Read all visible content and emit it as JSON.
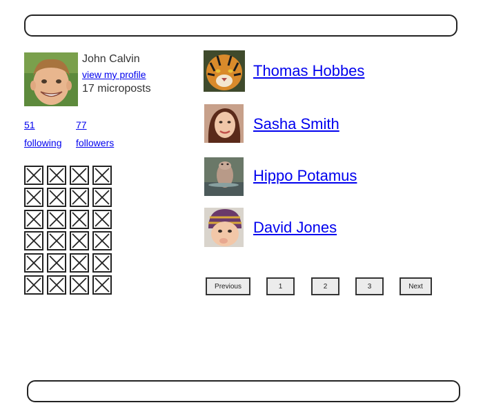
{
  "header": {},
  "profile": {
    "name": "John Calvin",
    "profile_link": "view my profile",
    "microposts": "17 microposts",
    "avatar_icon": "child-face-avatar"
  },
  "stats": {
    "following_count": "51",
    "following_label": "following",
    "followers_count": "77",
    "followers_label": "followers"
  },
  "image_grid": {
    "rows": 6,
    "cols": 4,
    "icon": "broken-image-icon"
  },
  "users": [
    {
      "name": "Thomas Hobbes",
      "avatar_icon": "tiger-avatar"
    },
    {
      "name": "Sasha Smith",
      "avatar_icon": "woman-avatar"
    },
    {
      "name": "Hippo Potamus",
      "avatar_icon": "hippo-avatar"
    },
    {
      "name": "David Jones",
      "avatar_icon": "baby-avatar"
    }
  ],
  "pagination": {
    "previous": "Previous",
    "pages": [
      "1",
      "2",
      "3"
    ],
    "next": "Next"
  },
  "colors": {
    "link": "#0000ee",
    "border": "#222222",
    "button_bg": "#ececec"
  }
}
